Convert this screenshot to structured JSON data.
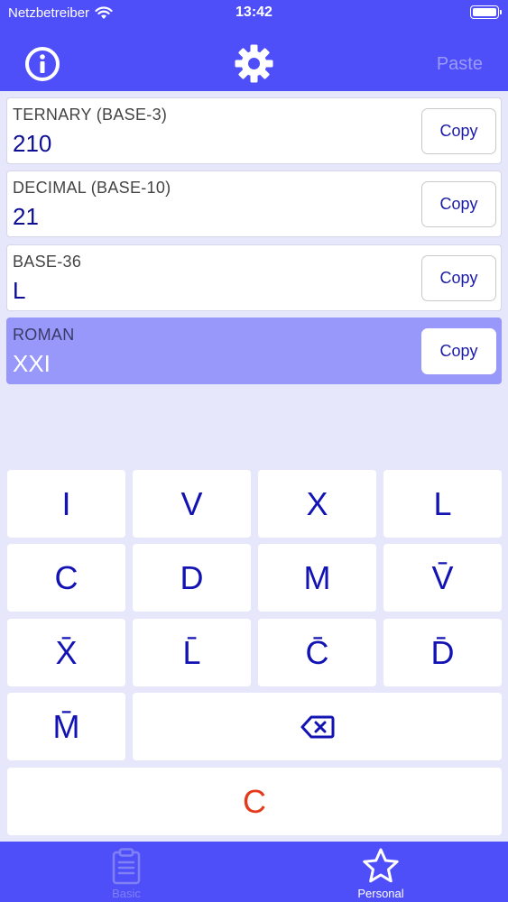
{
  "status": {
    "carrier": "Netzbetreiber",
    "time": "13:42"
  },
  "header": {
    "paste_label": "Paste"
  },
  "cards": [
    {
      "label": "TERNARY (BASE-3)",
      "value": "210",
      "copy_label": "Copy"
    },
    {
      "label": "DECIMAL (BASE-10)",
      "value": "21",
      "copy_label": "Copy"
    },
    {
      "label": "BASE-36",
      "value": "L",
      "copy_label": "Copy"
    },
    {
      "label": "ROMAN",
      "value": "XXI",
      "copy_label": "Copy"
    }
  ],
  "keys": {
    "i": "I",
    "v": "V",
    "x": "X",
    "l": "L",
    "c": "C",
    "d": "D",
    "m": "M",
    "v_bar": "V̄",
    "x_bar": "X̄",
    "l_bar": "L̄",
    "c_bar": "C̄",
    "d_bar": "D̄",
    "m_bar": "M̄",
    "clear": "C"
  },
  "tabs": [
    {
      "label": "Basic",
      "icon": "clipboard-icon"
    },
    {
      "label": "Personal",
      "icon": "star-icon"
    }
  ],
  "colors": {
    "accent": "#4f4ffa",
    "background": "#e7e7fb",
    "selected_card": "#9898fa",
    "key_text": "#1313b4",
    "clear_text": "#e23a1a"
  }
}
